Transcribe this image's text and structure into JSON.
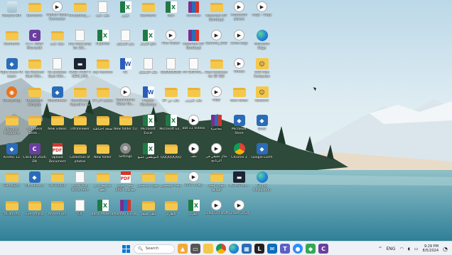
{
  "icons": [
    {
      "label": "Recycle Bin",
      "type": "recycle"
    },
    {
      "label": "Escritorio",
      "type": "folder"
    },
    {
      "label": "HitPaw Video Converter",
      "type": "video"
    },
    {
      "label": "Everybody_…",
      "type": "folder"
    },
    {
      "label": "ملف جديد",
      "type": "doc"
    },
    {
      "label": "تقرير",
      "type": "excel"
    },
    {
      "label": "Escritorio",
      "type": "folder"
    },
    {
      "label": "text",
      "type": "excel"
    },
    {
      "label": "Archivos",
      "type": "rar"
    },
    {
      "label": "Materials (IIT Bombay)",
      "type": "folder"
    },
    {
      "label": "Attraction places",
      "type": "video"
    },
    {
      "label": "copy - Copy",
      "type": "video"
    },
    {
      "label": "Escritorio",
      "type": "folder"
    },
    {
      "label": "C++ 2024 Microsoft",
      "type": "app-c"
    },
    {
      "label": "مجلد جديد",
      "type": "folder"
    },
    {
      "label": "the more play for ZU...",
      "type": "doc"
    },
    {
      "label": "FILEPRO",
      "type": "excel"
    },
    {
      "label": "رقم التسجيل",
      "type": "doc"
    },
    {
      "label": "نتائج الفصل",
      "type": "excel"
    },
    {
      "label": "Fine Visitor",
      "type": "video"
    },
    {
      "label": "Materials (IIT Bombay)",
      "type": "rar"
    },
    {
      "label": "Gamma_3RD",
      "type": "video"
    },
    {
      "label": "write-copy",
      "type": "video"
    },
    {
      "label": "Microsoft Edge",
      "type": "edge"
    },
    {
      "label": "Fight Score PC team",
      "type": "blue"
    },
    {
      "label": "My Beloved Best Wid...",
      "type": "folder"
    },
    {
      "label": "Re prolotes Best Wid...",
      "type": "doc"
    },
    {
      "label": "CASE CROP 2 NEW_IMG",
      "type": "dark"
    },
    {
      "label": "say hesman",
      "type": "folder"
    },
    {
      "label": "R1",
      "type": "word"
    },
    {
      "label": "ملف التسجيل",
      "type": "doc"
    },
    {
      "label": "QQQQQQQQ",
      "type": "doc"
    },
    {
      "label": "MY DIGITAL...",
      "type": "doc"
    },
    {
      "label": "Best business for BY BIZ",
      "type": "folder"
    },
    {
      "label": "Videos",
      "type": "video"
    },
    {
      "label": "UCB Mae Computer",
      "type": "user"
    },
    {
      "label": "Everything",
      "type": "orange"
    },
    {
      "label": "Presented Amazon",
      "type": "folder"
    },
    {
      "label": "UltraViewer",
      "type": "blue"
    },
    {
      "label": "RecoGraze Payroll In Tu",
      "type": "folder"
    },
    {
      "label": "مناقشة 9 و 27",
      "type": "folder"
    },
    {
      "label": "Stadiumlife Water Bo...",
      "type": "video"
    },
    {
      "label": "Project Workshop",
      "type": "word"
    },
    {
      "label": "ملف من 87",
      "type": "folder"
    },
    {
      "label": "ملف تجريبي",
      "type": "folder"
    },
    {
      "label": "copy",
      "type": "video"
    },
    {
      "label": "New folder",
      "type": "folder"
    },
    {
      "label": "Network",
      "type": "user"
    },
    {
      "label": "Portable Programs",
      "type": "folder"
    },
    {
      "label": "Autodesk Desk...",
      "type": "folder"
    },
    {
      "label": "New videos",
      "type": "folder"
    },
    {
      "label": "UltraViewer",
      "type": "folder"
    },
    {
      "label": "نسخة احتياطية",
      "type": "folder"
    },
    {
      "label": "New folder (5)",
      "type": "folder"
    },
    {
      "label": "Microsoft Excel",
      "type": "excel"
    },
    {
      "label": "Microsoft Ex...",
      "type": "excel"
    },
    {
      "label": "Bat 11 Videos",
      "type": "video"
    },
    {
      "label": "محاضرة",
      "type": "rar"
    },
    {
      "label": "Microsoft Store",
      "type": "blue"
    },
    {
      "label": "Shell",
      "type": "blue"
    },
    {
      "label": "Kinetic 12",
      "type": "blue"
    },
    {
      "label": "Clara 10 2026 EN",
      "type": "app-c"
    },
    {
      "label": "Upload Document",
      "type": "pdf"
    },
    {
      "label": "Collection of photos",
      "type": "folder"
    },
    {
      "label": "New folder",
      "type": "folder"
    },
    {
      "label": "Settings",
      "type": "gear"
    },
    {
      "label": "الموظفين جميع",
      "type": "excel"
    },
    {
      "label": "QQQQQQQQ",
      "type": "folder"
    },
    {
      "label": "ملف",
      "type": "video"
    },
    {
      "label": "مثال حقيقي في البرنامج",
      "type": "video"
    },
    {
      "label": "Chrome 3",
      "type": "chrome"
    },
    {
      "label": "Google Earth",
      "type": "blue"
    },
    {
      "label": "GoodSync",
      "type": "folder"
    },
    {
      "label": "UltraViewer",
      "type": "blue"
    },
    {
      "label": "14-3-2024",
      "type": "folder"
    },
    {
      "label": "New Text Document",
      "type": "doc"
    },
    {
      "label": "فيديوهات تم رفعها",
      "type": "folder"
    },
    {
      "label": "خطة سنوية محاسبة 2024",
      "type": "pdf"
    },
    {
      "label": "نموذج مستخلص",
      "type": "folder"
    },
    {
      "label": "ملف الموظفين",
      "type": "folder"
    },
    {
      "label": "ملفات 2024",
      "type": "video"
    },
    {
      "label": "ملفات العمل السابقة",
      "type": "folder"
    },
    {
      "label": "MS US Bla...",
      "type": "dark"
    },
    {
      "label": "Global Navigation",
      "type": "edge"
    },
    {
      "label": "OCam.rts",
      "type": "folder"
    },
    {
      "label": "Everything",
      "type": "folder"
    },
    {
      "label": "Ahmed File",
      "type": "folder"
    },
    {
      "label": "CV",
      "type": "doc"
    },
    {
      "label": "Basic Material",
      "type": "excel"
    },
    {
      "label": "Alsarey Fundo",
      "type": "rar"
    },
    {
      "label": "ملف الشغل",
      "type": "folder"
    },
    {
      "label": "التقارير",
      "type": "folder"
    },
    {
      "label": "التقرير",
      "type": "excel"
    },
    {
      "label": "video DO stuff",
      "type": "video"
    },
    {
      "label": "Screen 2024",
      "type": "video"
    }
  ],
  "taskbar": {
    "search_placeholder": "Search",
    "start_label": "Start",
    "apps": [
      "widgets",
      "task-view",
      "file-explorer",
      "chrome",
      "edge",
      "store",
      "lmedia",
      "email",
      "teams",
      "zoom",
      "maps",
      "photos"
    ],
    "tray": {
      "language": "ENG",
      "time": "9:29 PM",
      "date": "8/5/2024"
    }
  },
  "colors": {
    "taskbar": "#eef1f5",
    "accent": "#0067c0"
  }
}
